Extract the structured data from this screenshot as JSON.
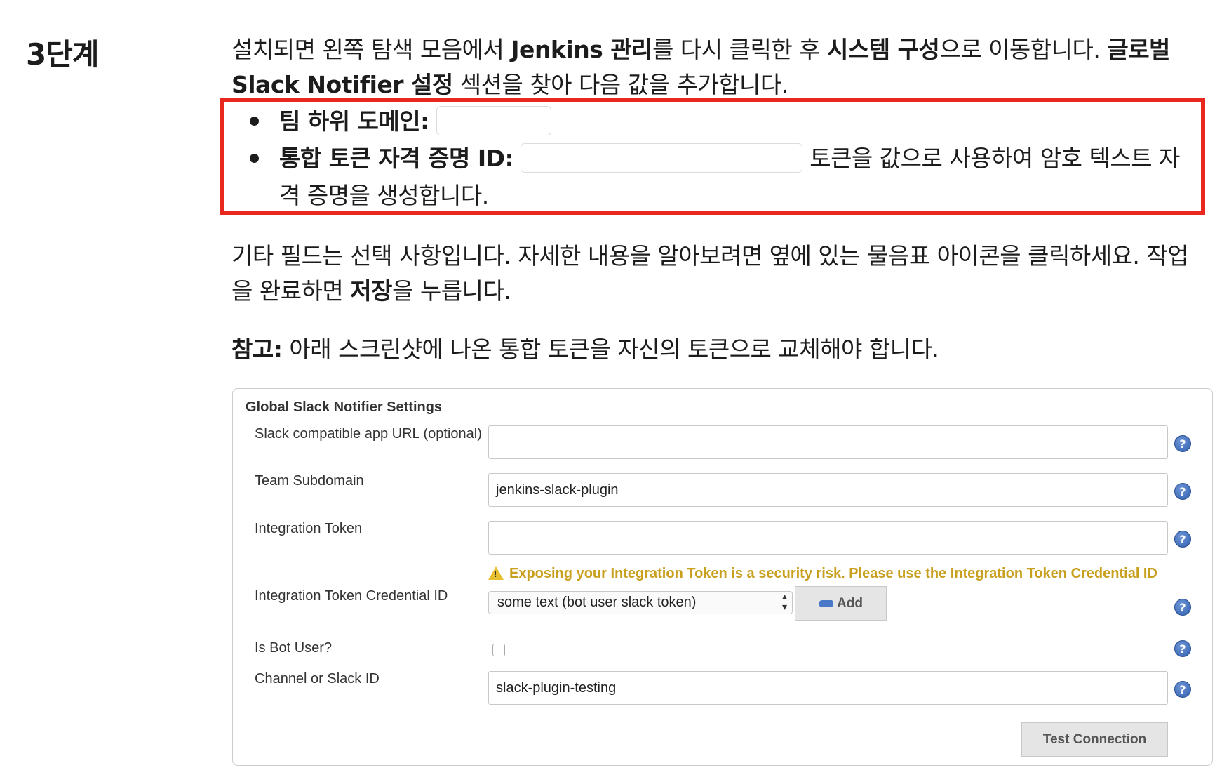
{
  "step": {
    "title": "3단계"
  },
  "intro": {
    "t1": "설치되면 왼쪽 탐색 모음에서 ",
    "b1": "Jenkins 관리",
    "t2": "를 다시 클릭한 후 ",
    "b2": "시스템 구성",
    "t3": "으로 이동합니다. ",
    "b3": "글로벌 Slack Notifier 설정",
    "t4": " 섹션을 찾아 다음 값을 추가합니다."
  },
  "bullets": {
    "item1_label": "팀 하위 도메인:",
    "item2_label": "통합 토큰 자격 증명 ID:",
    "item2_text": "토큰을 값으로 사용하여 암호 텍스트 자격 증명을 생성합니다."
  },
  "para2": {
    "t1": "기타 필드는 선택 사항입니다. 자세한 내용을 알아보려면 옆에 있는 물음표 아이콘을 클릭하세요. 작업을 완료하면 ",
    "b1": "저장",
    "t2": "을 누릅니다."
  },
  "note": {
    "label": "참고:",
    "text": " 아래 스크린샷에 나온 통합 토큰을 자신의 토큰으로 교체해야 합니다."
  },
  "panel": {
    "title": "Global Slack Notifier Settings",
    "app_url_label": "Slack compatible app URL (optional)",
    "app_url_value": "",
    "team_label": "Team Subdomain",
    "team_value": "jenkins-slack-plugin",
    "token_label": "Integration Token",
    "token_value": "",
    "warning": "Exposing your Integration Token is a security risk. Please use the Integration Token Credential ID",
    "cred_label": "Integration Token Credential ID",
    "cred_selected": "some text (bot user slack token)",
    "add_label": "Add",
    "bot_label": "Is Bot User?",
    "bot_checked": false,
    "channel_label": "Channel or Slack ID",
    "channel_value": "slack-plugin-testing",
    "test_label": "Test Connection"
  },
  "colors": {
    "highlight": "#e8281e",
    "warning": "#c8a01e",
    "help": "#2f5fb0"
  }
}
